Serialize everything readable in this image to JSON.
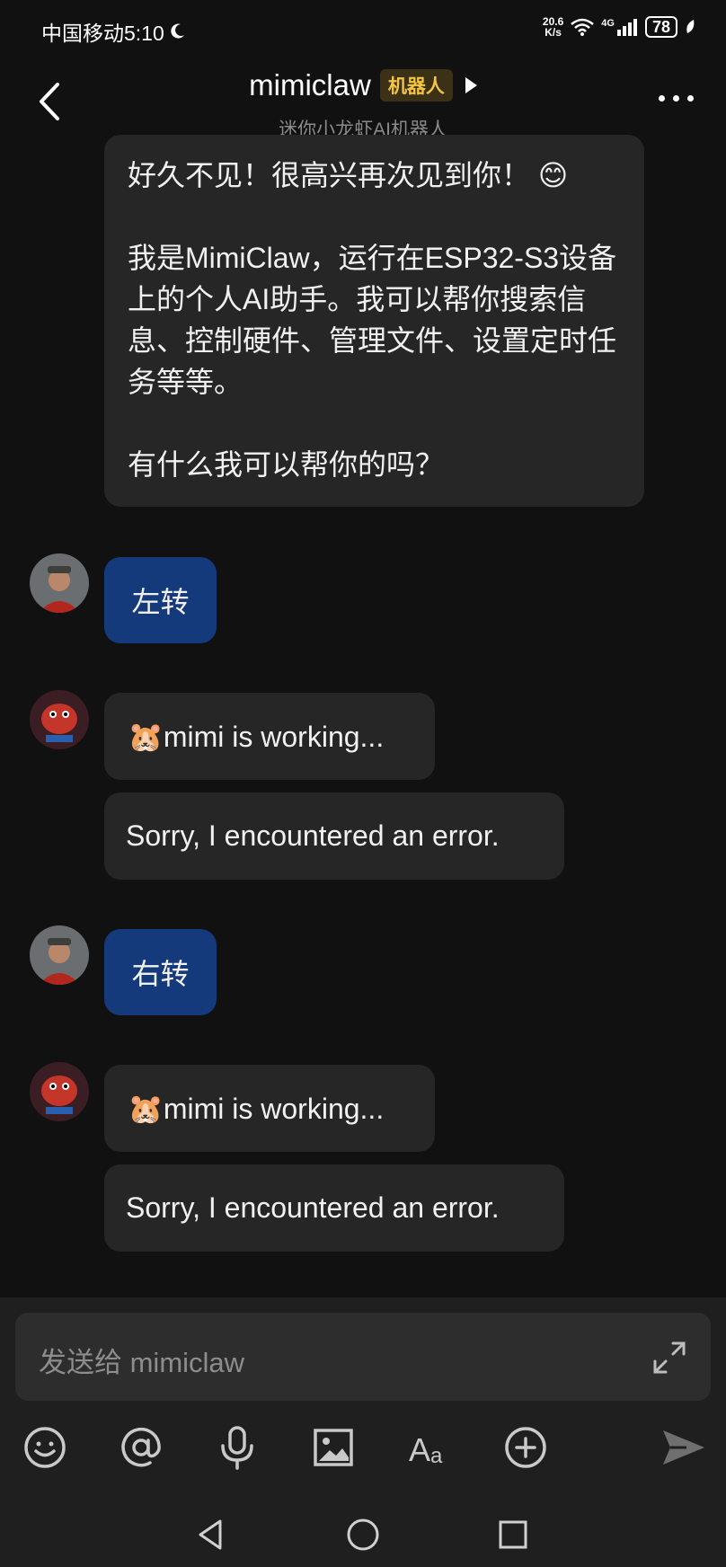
{
  "status_bar": {
    "carrier_time": "中国移动5:10",
    "net_speed_value": "20.6",
    "net_speed_unit": "K/s",
    "network": "4G",
    "battery": "78"
  },
  "header": {
    "title": "mimiclaw",
    "badge": "机器人",
    "subtitle": "迷你小龙虾AI机器人"
  },
  "messages": {
    "intro": {
      "line1": "好久不见！很高兴再次见到你！ 😊",
      "line2": "我是MimiClaw，运行在ESP32-S3设备上的个人AI助手。我可以帮你搜索信息、控制硬件、管理文件、设置定时任务等等。",
      "line3": "有什么我可以帮你的吗？"
    },
    "user1": "左转",
    "bot1_status": "🐹mimi is working...",
    "bot1_reply": "Sorry, I encountered an error.",
    "user2": "右转",
    "bot2_status": "🐹mimi is working...",
    "bot2_reply": "Sorry, I encountered an error."
  },
  "composer": {
    "placeholder": "发送给 mimiclaw",
    "tools": [
      "emoji-icon",
      "mention-icon",
      "microphone-icon",
      "image-icon",
      "text-format-icon",
      "add-icon",
      "send-icon"
    ]
  },
  "nav_bar": [
    "back-triangle-icon",
    "home-circle-icon",
    "recents-square-icon"
  ]
}
